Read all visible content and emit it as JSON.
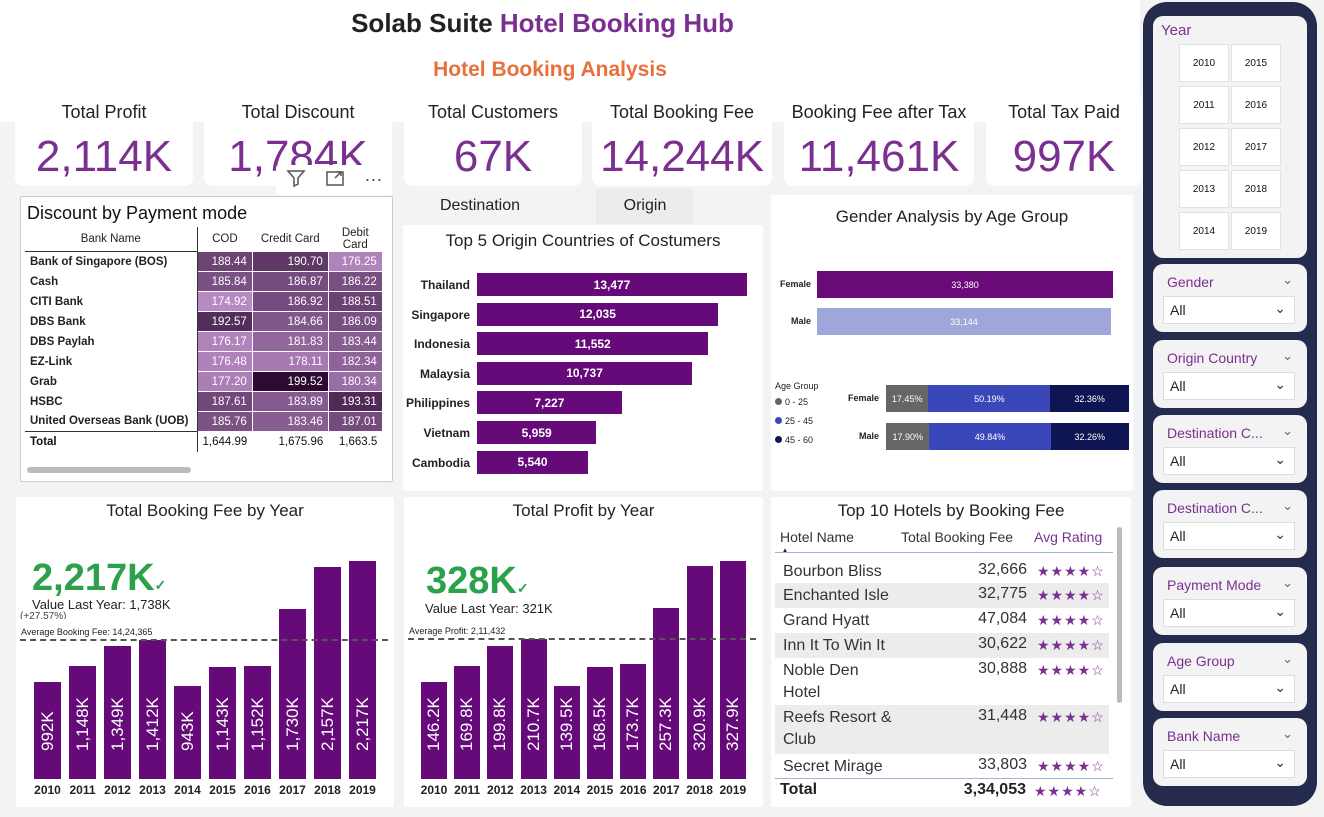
{
  "header": {
    "title_a": "Solab Suite",
    "title_b": "Hotel Booking Hub",
    "subtitle": "Hotel Booking Analysis"
  },
  "kpis": [
    {
      "label": "Total Profit",
      "value": "2,114K"
    },
    {
      "label": "Total Discount",
      "value": "1,784K"
    },
    {
      "label": "Total Customers",
      "value": "67K"
    },
    {
      "label": "Total Booking Fee",
      "value": "14,244K"
    },
    {
      "label": "Booking Fee after Tax",
      "value": "11,461K"
    },
    {
      "label": "Total Tax Paid",
      "value": "997K"
    }
  ],
  "toolbar": {
    "filter_icon": "filter-icon",
    "focus_icon": "focus-mode-icon",
    "more": "⋯"
  },
  "discount_table": {
    "title": "Discount by Payment mode",
    "columns": [
      "Bank Name",
      "COD",
      "Credit Card",
      "Debit Card"
    ],
    "rows": [
      {
        "bank": "Bank of Singapore (BOS)",
        "cod": "188.44",
        "credit": "190.70",
        "debit": "176.25"
      },
      {
        "bank": "Cash",
        "cod": "185.84",
        "credit": "186.87",
        "debit": "186.22"
      },
      {
        "bank": "CITI Bank",
        "cod": "174.92",
        "credit": "186.92",
        "debit": "188.51"
      },
      {
        "bank": "DBS Bank",
        "cod": "192.57",
        "credit": "184.66",
        "debit": "186.09"
      },
      {
        "bank": "DBS Paylah",
        "cod": "176.17",
        "credit": "181.83",
        "debit": "183.44"
      },
      {
        "bank": "EZ-Link",
        "cod": "176.48",
        "credit": "178.11",
        "debit": "182.34"
      },
      {
        "bank": "Grab",
        "cod": "177.20",
        "credit": "199.52",
        "debit": "180.34"
      },
      {
        "bank": "HSBC",
        "cod": "187.61",
        "credit": "183.89",
        "debit": "193.31"
      },
      {
        "bank": "United Overseas Bank (UOB)",
        "cod": "185.76",
        "credit": "183.46",
        "debit": "187.01"
      }
    ],
    "total": {
      "bank": "Total",
      "cod": "1,644.99",
      "credit": "1,675.96",
      "debit": "1,663.5"
    }
  },
  "tabs": {
    "destination": "Destination",
    "origin": "Origin"
  },
  "chart_data": [
    {
      "type": "bar",
      "title": "Top 5 Origin Countries of Costumers",
      "categories": [
        "Thailand",
        "Singapore",
        "Indonesia",
        "Malaysia",
        "Philippines",
        "Vietnam",
        "Cambodia"
      ],
      "values": [
        13477,
        12035,
        11552,
        10737,
        7227,
        5959,
        5540
      ],
      "value_labels": [
        "13,477",
        "12,035",
        "11,552",
        "10,737",
        "7,227",
        "5,959",
        "5,540"
      ]
    },
    {
      "type": "bar",
      "title": "Gender Analysis by Age Group",
      "categories": [
        "Female",
        "Male"
      ],
      "values": [
        33380,
        33144
      ],
      "value_labels": [
        "33,380",
        "33,144"
      ],
      "colors": [
        "#6a0a78",
        "#9fa6d9"
      ]
    },
    {
      "type": "bar",
      "title": "",
      "legend_title": "Age Group",
      "categories": [
        "Female",
        "Male"
      ],
      "series": [
        {
          "name": "0 - 25",
          "values": [
            17.45,
            17.9
          ],
          "labels": [
            "17.45%",
            "17.90%"
          ],
          "color": "#666666"
        },
        {
          "name": "25 - 45",
          "values": [
            50.19,
            49.84
          ],
          "labels": [
            "50.19%",
            "49.84%"
          ],
          "color": "#3a47b8"
        },
        {
          "name": "45 - 60",
          "values": [
            32.36,
            32.26
          ],
          "labels": [
            "32.36%",
            "32.26%"
          ],
          "color": "#0e1552"
        }
      ]
    },
    {
      "type": "bar",
      "title": "Total Booking Fee by Year",
      "categories": [
        "2010",
        "2011",
        "2012",
        "2013",
        "2014",
        "2015",
        "2016",
        "2017",
        "2018",
        "2019"
      ],
      "values": [
        992,
        1148,
        1349,
        1412,
        943,
        1143,
        1152,
        1730,
        2157,
        2217
      ],
      "value_labels": [
        "992K",
        "1,148K",
        "1,349K",
        "1,412K",
        "943K",
        "1,143K",
        "1,152K",
        "1,730K",
        "2,157K",
        "2,217K"
      ],
      "ylim": [
        0,
        2300
      ],
      "average": 1424.365,
      "average_label": "Average Booking Fee: 14,24,365"
    },
    {
      "type": "bar",
      "title": "Total Profit by Year",
      "categories": [
        "2010",
        "2011",
        "2012",
        "2013",
        "2014",
        "2015",
        "2016",
        "2017",
        "2018",
        "2019"
      ],
      "values": [
        146.2,
        169.8,
        199.8,
        210.7,
        139.5,
        168.5,
        173.7,
        257.3,
        320.9,
        327.9
      ],
      "value_labels": [
        "146.2K",
        "169.8K",
        "199.8K",
        "210.7K",
        "139.5K",
        "168.5K",
        "173.7K",
        "257.3K",
        "320.9K",
        "327.9K"
      ],
      "ylim": [
        0,
        340
      ],
      "average": 211.432,
      "average_label": "Average Profit: 2,11,432"
    }
  ],
  "booking_kpi": {
    "value": "2,217K",
    "check": "✓",
    "sub": "Value Last Year: 1,738K",
    "cut": "(+27.57%)"
  },
  "profit_kpi": {
    "value": "328K",
    "check": "✓",
    "sub": "Value Last Year: 321K"
  },
  "hotels": {
    "title": "Top 10 Hotels by Booking Fee",
    "columns": [
      "Hotel Name",
      "Total Booking Fee",
      "Avg Rating"
    ],
    "rows": [
      {
        "name": "Bourbon Bliss",
        "fee": "32,666",
        "stars": "★★★★☆"
      },
      {
        "name": "Enchanted Isle",
        "fee": "32,775",
        "stars": "★★★★☆"
      },
      {
        "name": "Grand Hyatt",
        "fee": "47,084",
        "stars": "★★★★☆"
      },
      {
        "name": "Inn It To Win It",
        "fee": "30,622",
        "stars": "★★★★☆"
      },
      {
        "name": "Noble Den Hotel",
        "fee": "30,888",
        "stars": "★★★★☆"
      },
      {
        "name": "Reefs Resort & Club",
        "fee": "31,448",
        "stars": "★★★★☆"
      },
      {
        "name": "Secret Mirage",
        "fee": "33,803",
        "stars": "★★★★☆"
      }
    ],
    "total": {
      "name": "Total",
      "fee": "3,34,053",
      "stars": "★★★★☆"
    }
  },
  "slicers": {
    "year": {
      "title": "Year",
      "options": [
        "2010",
        "2015",
        "2011",
        "2016",
        "2012",
        "2017",
        "2013",
        "2018",
        "2014",
        "2019"
      ]
    },
    "filters": [
      {
        "title": "Gender",
        "value": "All"
      },
      {
        "title": "Origin Country",
        "value": "All"
      },
      {
        "title": "Destination C...",
        "value": "All"
      },
      {
        "title": "Destination C...",
        "value": "All"
      },
      {
        "title": "Payment Mode",
        "value": "All"
      },
      {
        "title": "Age Group",
        "value": "All"
      },
      {
        "title": "Bank Name",
        "value": "All"
      }
    ]
  }
}
